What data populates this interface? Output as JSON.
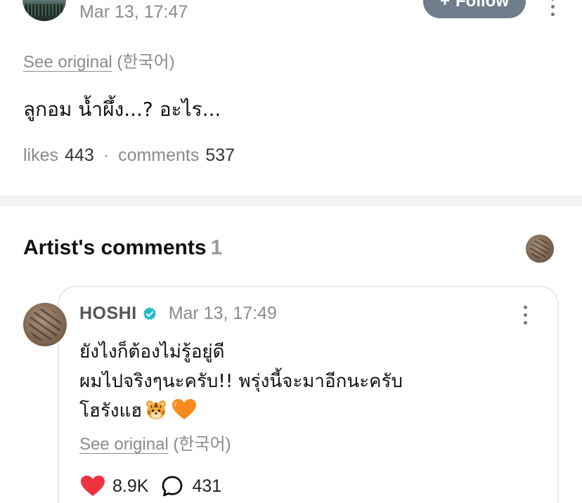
{
  "post": {
    "date": "Mar 13, 17:47",
    "follow_label": "Follow",
    "see_original": "See original",
    "original_lang": "(한국어)",
    "text": "ลูกอม น้ำผึ้ง...? อะไร...",
    "likes_label": "likes",
    "likes": "443",
    "separator": "·",
    "comments_label": "comments",
    "comments": "537"
  },
  "artist_comments": {
    "title": "Artist's comments",
    "count": "1"
  },
  "comment": {
    "author": "HOSHI",
    "date": "Mar 13, 17:49",
    "lines": [
      "ยังไงก็ต้องไม่รู้อยู่ดี",
      "ผมไปจริงๆนะครับ!! พรุ่งนี้จะมาอีกนะครับ",
      "โฮรังแฮ"
    ],
    "see_original": "See original",
    "original_lang": "(한국어)",
    "likes": "8.9K",
    "comments": "431"
  },
  "colors": {
    "follow_button": "#6f7d8c",
    "verified_badge": "#22b8cf",
    "heart": "#ee3340",
    "orange_heart": "#f78a1d",
    "muted_text": "#8b8b8b"
  },
  "icons": [
    "plus-icon",
    "more-vertical-icon",
    "verified-icon",
    "tiger-emoji",
    "orange-heart-emoji",
    "heart-icon",
    "comment-bubble-icon"
  ]
}
